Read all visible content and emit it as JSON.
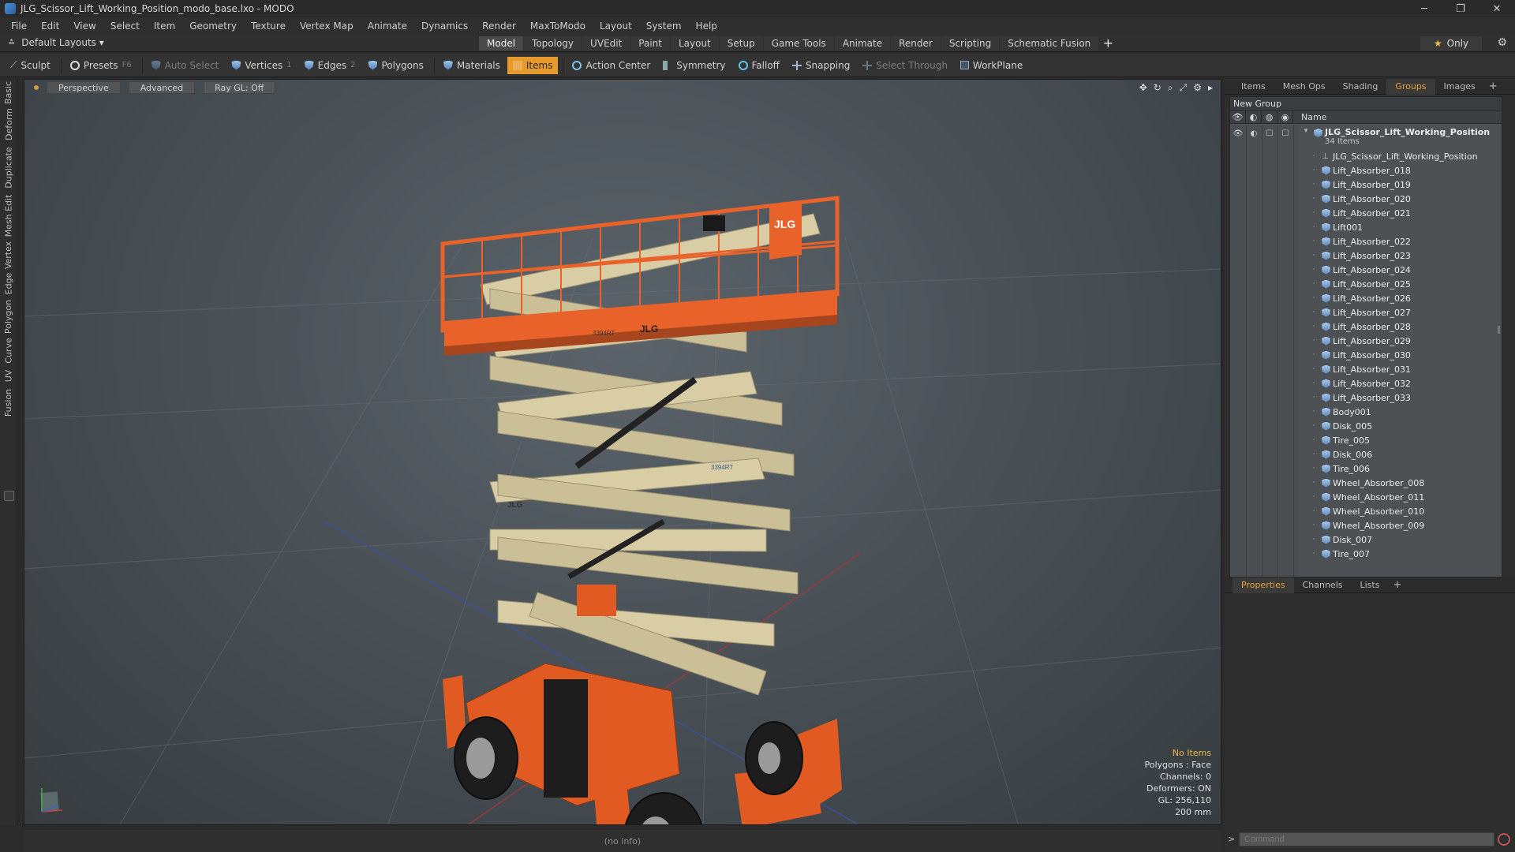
{
  "window": {
    "title": "JLG_Scissor_Lift_Working_Position_modo_base.lxo - MODO",
    "controls": [
      "─",
      "❐",
      "✕"
    ]
  },
  "menu": [
    "File",
    "Edit",
    "View",
    "Select",
    "Item",
    "Geometry",
    "Texture",
    "Vertex Map",
    "Animate",
    "Dynamics",
    "Render",
    "MaxToModo",
    "Layout",
    "System",
    "Help"
  ],
  "layout_bar": {
    "layout_select": "Default Layouts ▾",
    "tabs": [
      "Model",
      "Topology",
      "UVEdit",
      "Paint",
      "Layout",
      "Setup",
      "Game Tools",
      "Animate",
      "Render",
      "Scripting",
      "Schematic Fusion"
    ],
    "active_tab": "Model",
    "plus": "+",
    "only_label": "Only",
    "only_star": "★"
  },
  "toolbar": {
    "sculpt": "Sculpt",
    "presets": "Presets",
    "presets_key": "F6",
    "auto_select": "Auto Select",
    "vertices": "Vertices",
    "vertices_key": "1",
    "edges": "Edges",
    "edges_key": "2",
    "polygons": "Polygons",
    "materials": "Materials",
    "items": "Items",
    "action_center": "Action Center",
    "symmetry": "Symmetry",
    "falloff": "Falloff",
    "snapping": "Snapping",
    "select_through": "Select Through",
    "workplane": "WorkPlane"
  },
  "left_tabs": [
    "Basic",
    "Deform",
    "Duplicate",
    "Mesh Edit",
    "Vertex",
    "Edge",
    "Polygon",
    "Curve",
    "UV",
    "Fusion"
  ],
  "viewport": {
    "view_mode": "Perspective",
    "shading": "Advanced",
    "raygl": "Ray GL: Off",
    "tools": [
      "✥",
      "↻",
      "⌕",
      "⤢",
      "⚙",
      "▸"
    ],
    "info": {
      "selection": "No Items",
      "polygons": "Polygons : Face",
      "channels": "Channels: 0",
      "deformers": "Deformers: ON",
      "gl": "GL: 256,110",
      "scale": "200 mm"
    },
    "colors": {
      "platform": "#e8622a",
      "scissor": "#d9cda5",
      "chassis": "#e05a22",
      "tire": "#1d1d1d"
    },
    "platform_brand": "JLG",
    "platform_serial": "3394RT",
    "scissor_brand": "JLG",
    "scissor_serial": "3394RT"
  },
  "status_bar": "(no info)",
  "right_panel": {
    "top_tabs": [
      "Items",
      "Mesh Ops",
      "Shading",
      "Groups",
      "Images"
    ],
    "active_top_tab": "Groups",
    "new_group": "New Group",
    "name_header": "Name",
    "group": {
      "name": "JLG_Scissor_Lift_Working_Position",
      "count": "34 Items"
    },
    "items": [
      {
        "name": "JLG_Scissor_Lift_Working_Position",
        "icon": "locator-icon"
      },
      {
        "name": "Lift_Absorber_018",
        "icon": "mesh-icon"
      },
      {
        "name": "Lift_Absorber_019",
        "icon": "mesh-icon"
      },
      {
        "name": "Lift_Absorber_020",
        "icon": "mesh-icon"
      },
      {
        "name": "Lift_Absorber_021",
        "icon": "mesh-icon"
      },
      {
        "name": "Lift001",
        "icon": "mesh-icon"
      },
      {
        "name": "Lift_Absorber_022",
        "icon": "mesh-icon"
      },
      {
        "name": "Lift_Absorber_023",
        "icon": "mesh-icon"
      },
      {
        "name": "Lift_Absorber_024",
        "icon": "mesh-icon"
      },
      {
        "name": "Lift_Absorber_025",
        "icon": "mesh-icon"
      },
      {
        "name": "Lift_Absorber_026",
        "icon": "mesh-icon"
      },
      {
        "name": "Lift_Absorber_027",
        "icon": "mesh-icon"
      },
      {
        "name": "Lift_Absorber_028",
        "icon": "mesh-icon"
      },
      {
        "name": "Lift_Absorber_029",
        "icon": "mesh-icon"
      },
      {
        "name": "Lift_Absorber_030",
        "icon": "mesh-icon"
      },
      {
        "name": "Lift_Absorber_031",
        "icon": "mesh-icon"
      },
      {
        "name": "Lift_Absorber_032",
        "icon": "mesh-icon"
      },
      {
        "name": "Lift_Absorber_033",
        "icon": "mesh-icon"
      },
      {
        "name": "Body001",
        "icon": "mesh-icon"
      },
      {
        "name": "Disk_005",
        "icon": "mesh-icon"
      },
      {
        "name": "Tire_005",
        "icon": "mesh-icon"
      },
      {
        "name": "Disk_006",
        "icon": "mesh-icon"
      },
      {
        "name": "Tire_006",
        "icon": "mesh-icon"
      },
      {
        "name": "Wheel_Absorber_008",
        "icon": "mesh-icon"
      },
      {
        "name": "Wheel_Absorber_011",
        "icon": "mesh-icon"
      },
      {
        "name": "Wheel_Absorber_010",
        "icon": "mesh-icon"
      },
      {
        "name": "Wheel_Absorber_009",
        "icon": "mesh-icon"
      },
      {
        "name": "Disk_007",
        "icon": "mesh-icon"
      },
      {
        "name": "Tire_007",
        "icon": "mesh-icon"
      }
    ],
    "bottom_tabs": [
      "Properties",
      "Channels",
      "Lists"
    ],
    "active_bottom_tab": "Properties",
    "command_placeholder": "Command",
    "command_prompt": ">"
  }
}
